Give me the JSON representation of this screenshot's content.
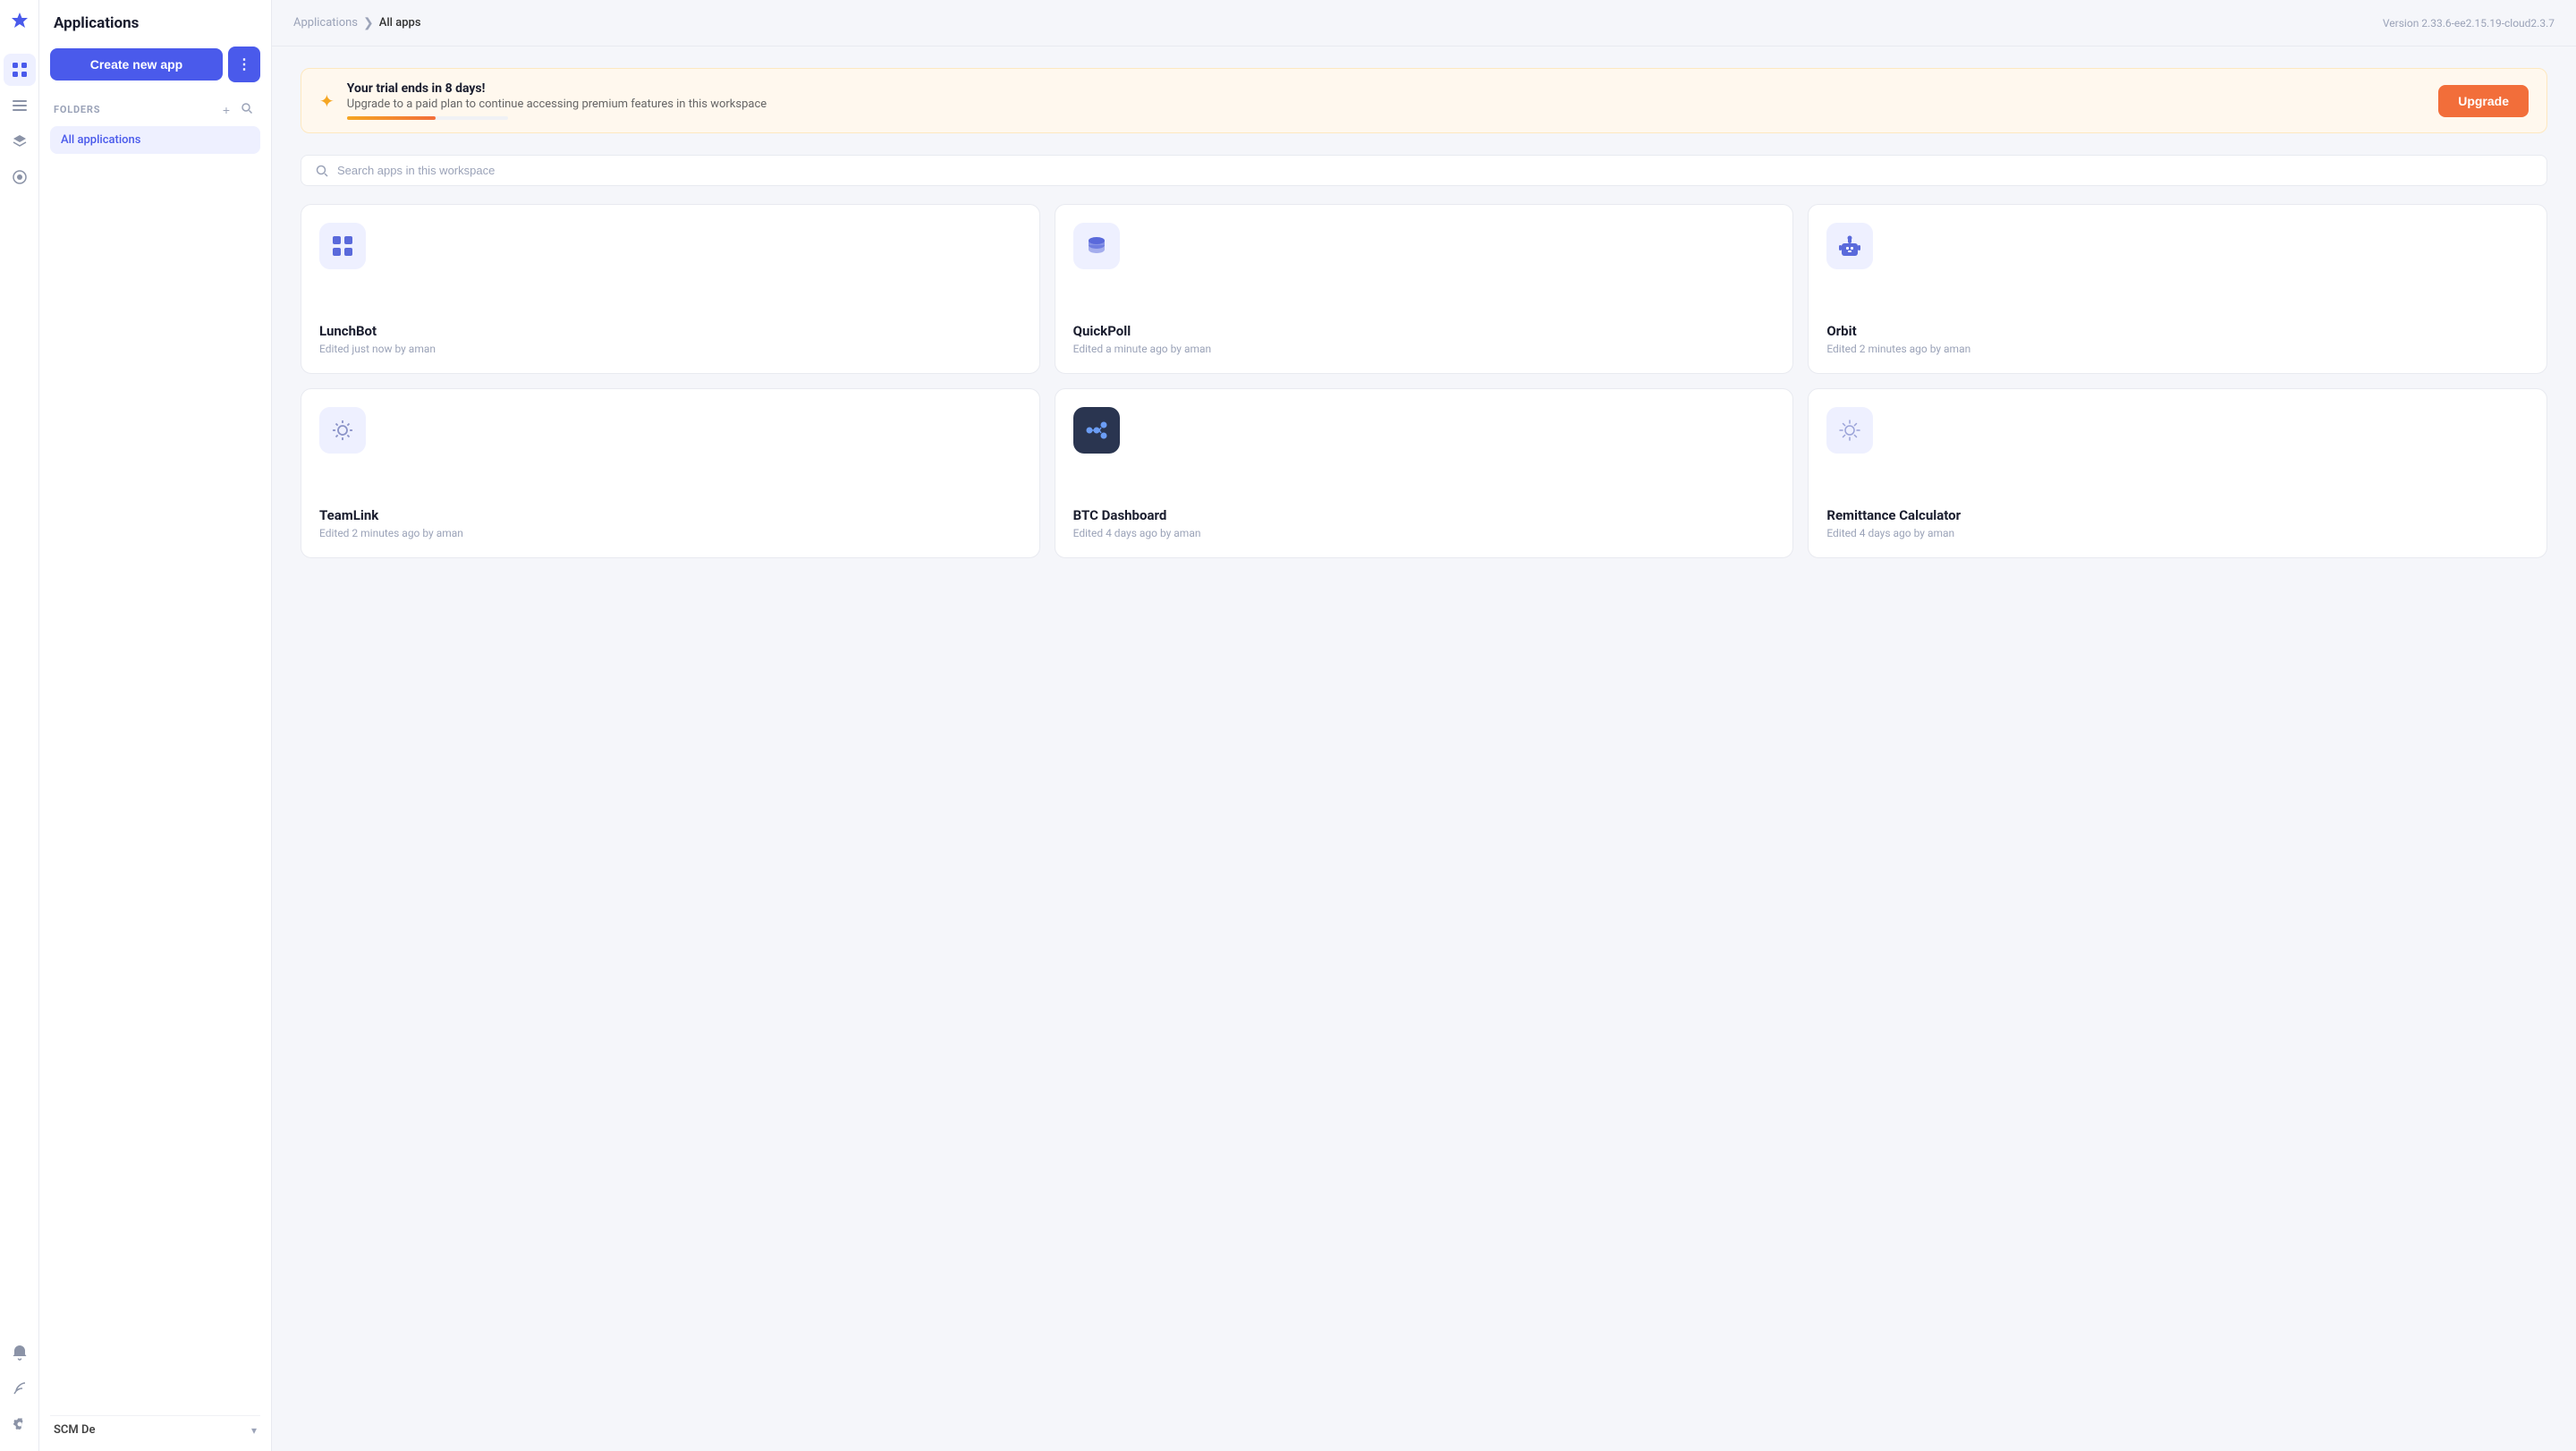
{
  "app": {
    "version": "Version 2.33.6-ee2.15.19-cloud2.3.7"
  },
  "iconRail": {
    "logo": "🚀",
    "navItems": [
      {
        "id": "grid",
        "icon": "⊞",
        "active": true
      },
      {
        "id": "list",
        "icon": "☰",
        "active": false
      },
      {
        "id": "layers",
        "icon": "◫",
        "active": false
      },
      {
        "id": "gear",
        "icon": "⚙",
        "active": false
      }
    ],
    "bottomItems": [
      {
        "id": "bell",
        "icon": "🔔"
      },
      {
        "id": "feather",
        "icon": "🪶"
      },
      {
        "id": "settings",
        "icon": "⚙"
      }
    ]
  },
  "sidebar": {
    "title": "Applications",
    "createButton": "Create new app",
    "dotsButton": "⋮",
    "foldersLabel": "FOLDERS",
    "addButton": "+",
    "searchButton": "🔍",
    "items": [
      {
        "label": "All applications",
        "active": true
      }
    ],
    "footer": {
      "workspaceName": "SCM De",
      "chevron": "▾"
    }
  },
  "topbar": {
    "breadcrumb": {
      "parent": "Applications",
      "separator": "❯",
      "current": "All apps"
    }
  },
  "trialBanner": {
    "icon": "✦",
    "title": "Your trial ends in 8 days!",
    "subtitle": "Upgrade to a paid plan to continue accessing premium features in this workspace",
    "progressPercent": 55,
    "upgradeButton": "Upgrade"
  },
  "search": {
    "placeholder": "Search apps in this workspace"
  },
  "apps": [
    {
      "id": "lunchbot",
      "name": "LunchBot",
      "meta": "Edited just now by aman",
      "iconType": "grid",
      "iconBg": "#eef0ff",
      "iconColor": "#5a6adb"
    },
    {
      "id": "quickpoll",
      "name": "QuickPoll",
      "meta": "Edited a minute ago by aman",
      "iconType": "database",
      "iconBg": "#eef0ff",
      "iconColor": "#5a6adb"
    },
    {
      "id": "orbit",
      "name": "Orbit",
      "meta": "Edited 2 minutes ago by aman",
      "iconType": "robot",
      "iconBg": "#eef0ff",
      "iconColor": "#5a6adb"
    },
    {
      "id": "teamlink",
      "name": "TeamLink",
      "meta": "Edited 2 minutes ago by aman",
      "iconType": "sun",
      "iconBg": "#eef0ff",
      "iconColor": "#8b93c8"
    },
    {
      "id": "btcdashboard",
      "name": "BTC Dashboard",
      "meta": "Edited 4 days ago by aman",
      "iconType": "share",
      "iconBg": "#2a3550",
      "iconColor": "#6b9df5"
    },
    {
      "id": "remittance",
      "name": "Remittance Calculator",
      "meta": "Edited 4 days ago by aman",
      "iconType": "sun-light",
      "iconBg": "#eef0ff",
      "iconColor": "#9ba3d8"
    }
  ]
}
